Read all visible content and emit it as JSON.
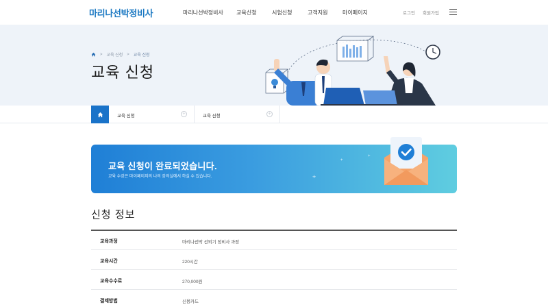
{
  "header": {
    "logo": "마리나선박정비사",
    "nav": [
      "마리나선박정비사",
      "교육신청",
      "시험신청",
      "고객지원",
      "마이페이지"
    ],
    "login": "로그인",
    "join": "회원가입"
  },
  "hero": {
    "breadcrumb": [
      "교육 신청",
      "교육 신청"
    ],
    "title": "교육 신청"
  },
  "subnav": {
    "select1": "교육 신청",
    "select2": "교육 신청"
  },
  "banner": {
    "title": "교육 신청이 완료되었습니다.",
    "subtitle": "교육 수강은 마이페이지의 나의 강의실에서 하실 수 있습니다."
  },
  "section": {
    "title": "신청 정보"
  },
  "info": [
    {
      "label": "교육과정",
      "value": "마리나선박 선외기 정비사 과정"
    },
    {
      "label": "교육시간",
      "value": "220시간"
    },
    {
      "label": "교육수수료",
      "value": "270,000원"
    },
    {
      "label": "결제방법",
      "value": "신용카드"
    }
  ],
  "colors": {
    "brand": "#1a78c2",
    "hero_bg": "#eef3f9",
    "banner_start": "#1f7fd6",
    "banner_end": "#5fcde0"
  },
  "icons": [
    "home-icon",
    "menu-icon",
    "plus-circle-icon",
    "check-icon",
    "envelope-icon"
  ]
}
